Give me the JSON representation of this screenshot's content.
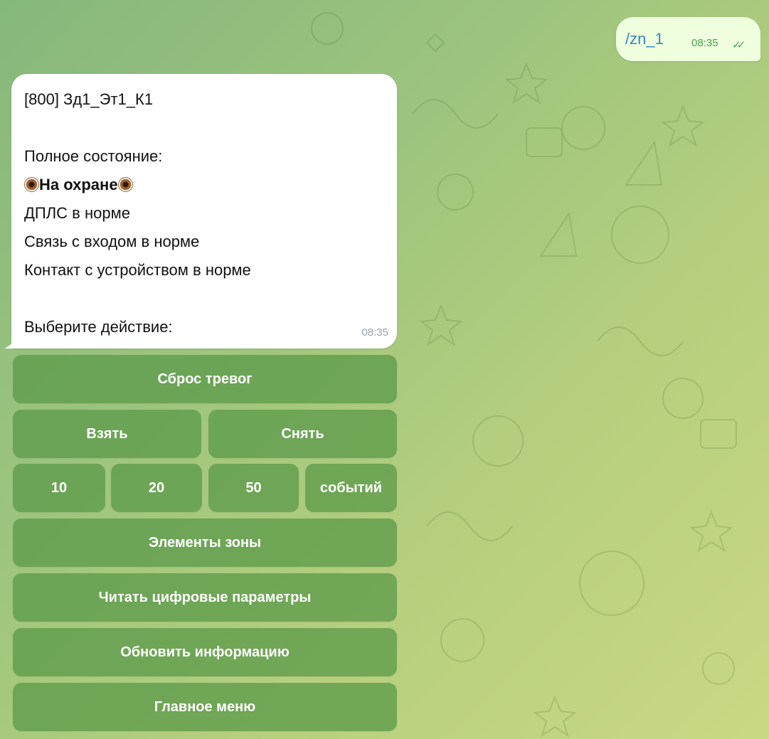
{
  "outgoing": {
    "command": "/zn_1",
    "time": "08:35",
    "status": "read"
  },
  "incoming": {
    "lines": [
      "[800] Зд1_Эт1_К1",
      "",
      "Полное состояние:",
      "На охране",
      "ДПЛС в норме",
      "Связь с входом в норме",
      "Контакт с устройством в норме",
      "",
      "Выберите действие:"
    ],
    "time": "08:35"
  },
  "keyboard": {
    "reset_alarms": "Сброс тревог",
    "arm": "Взять",
    "disarm": "Снять",
    "n10": "10",
    "n20": "20",
    "n50": "50",
    "events": "событий",
    "zone_elements": "Элементы зоны",
    "read_digital_params": "Читать цифровые параметры",
    "refresh_info": "Обновить информацию",
    "main_menu": "Главное меню"
  },
  "colors": {
    "outgoing_bubble": "#efffde",
    "incoming_bubble": "#ffffff",
    "keyboard_button": "#5d9b4a",
    "link_text": "#2f86c7",
    "read_check": "#4aa34d"
  },
  "icons": [
    "eye-icon",
    "double-check-icon"
  ]
}
